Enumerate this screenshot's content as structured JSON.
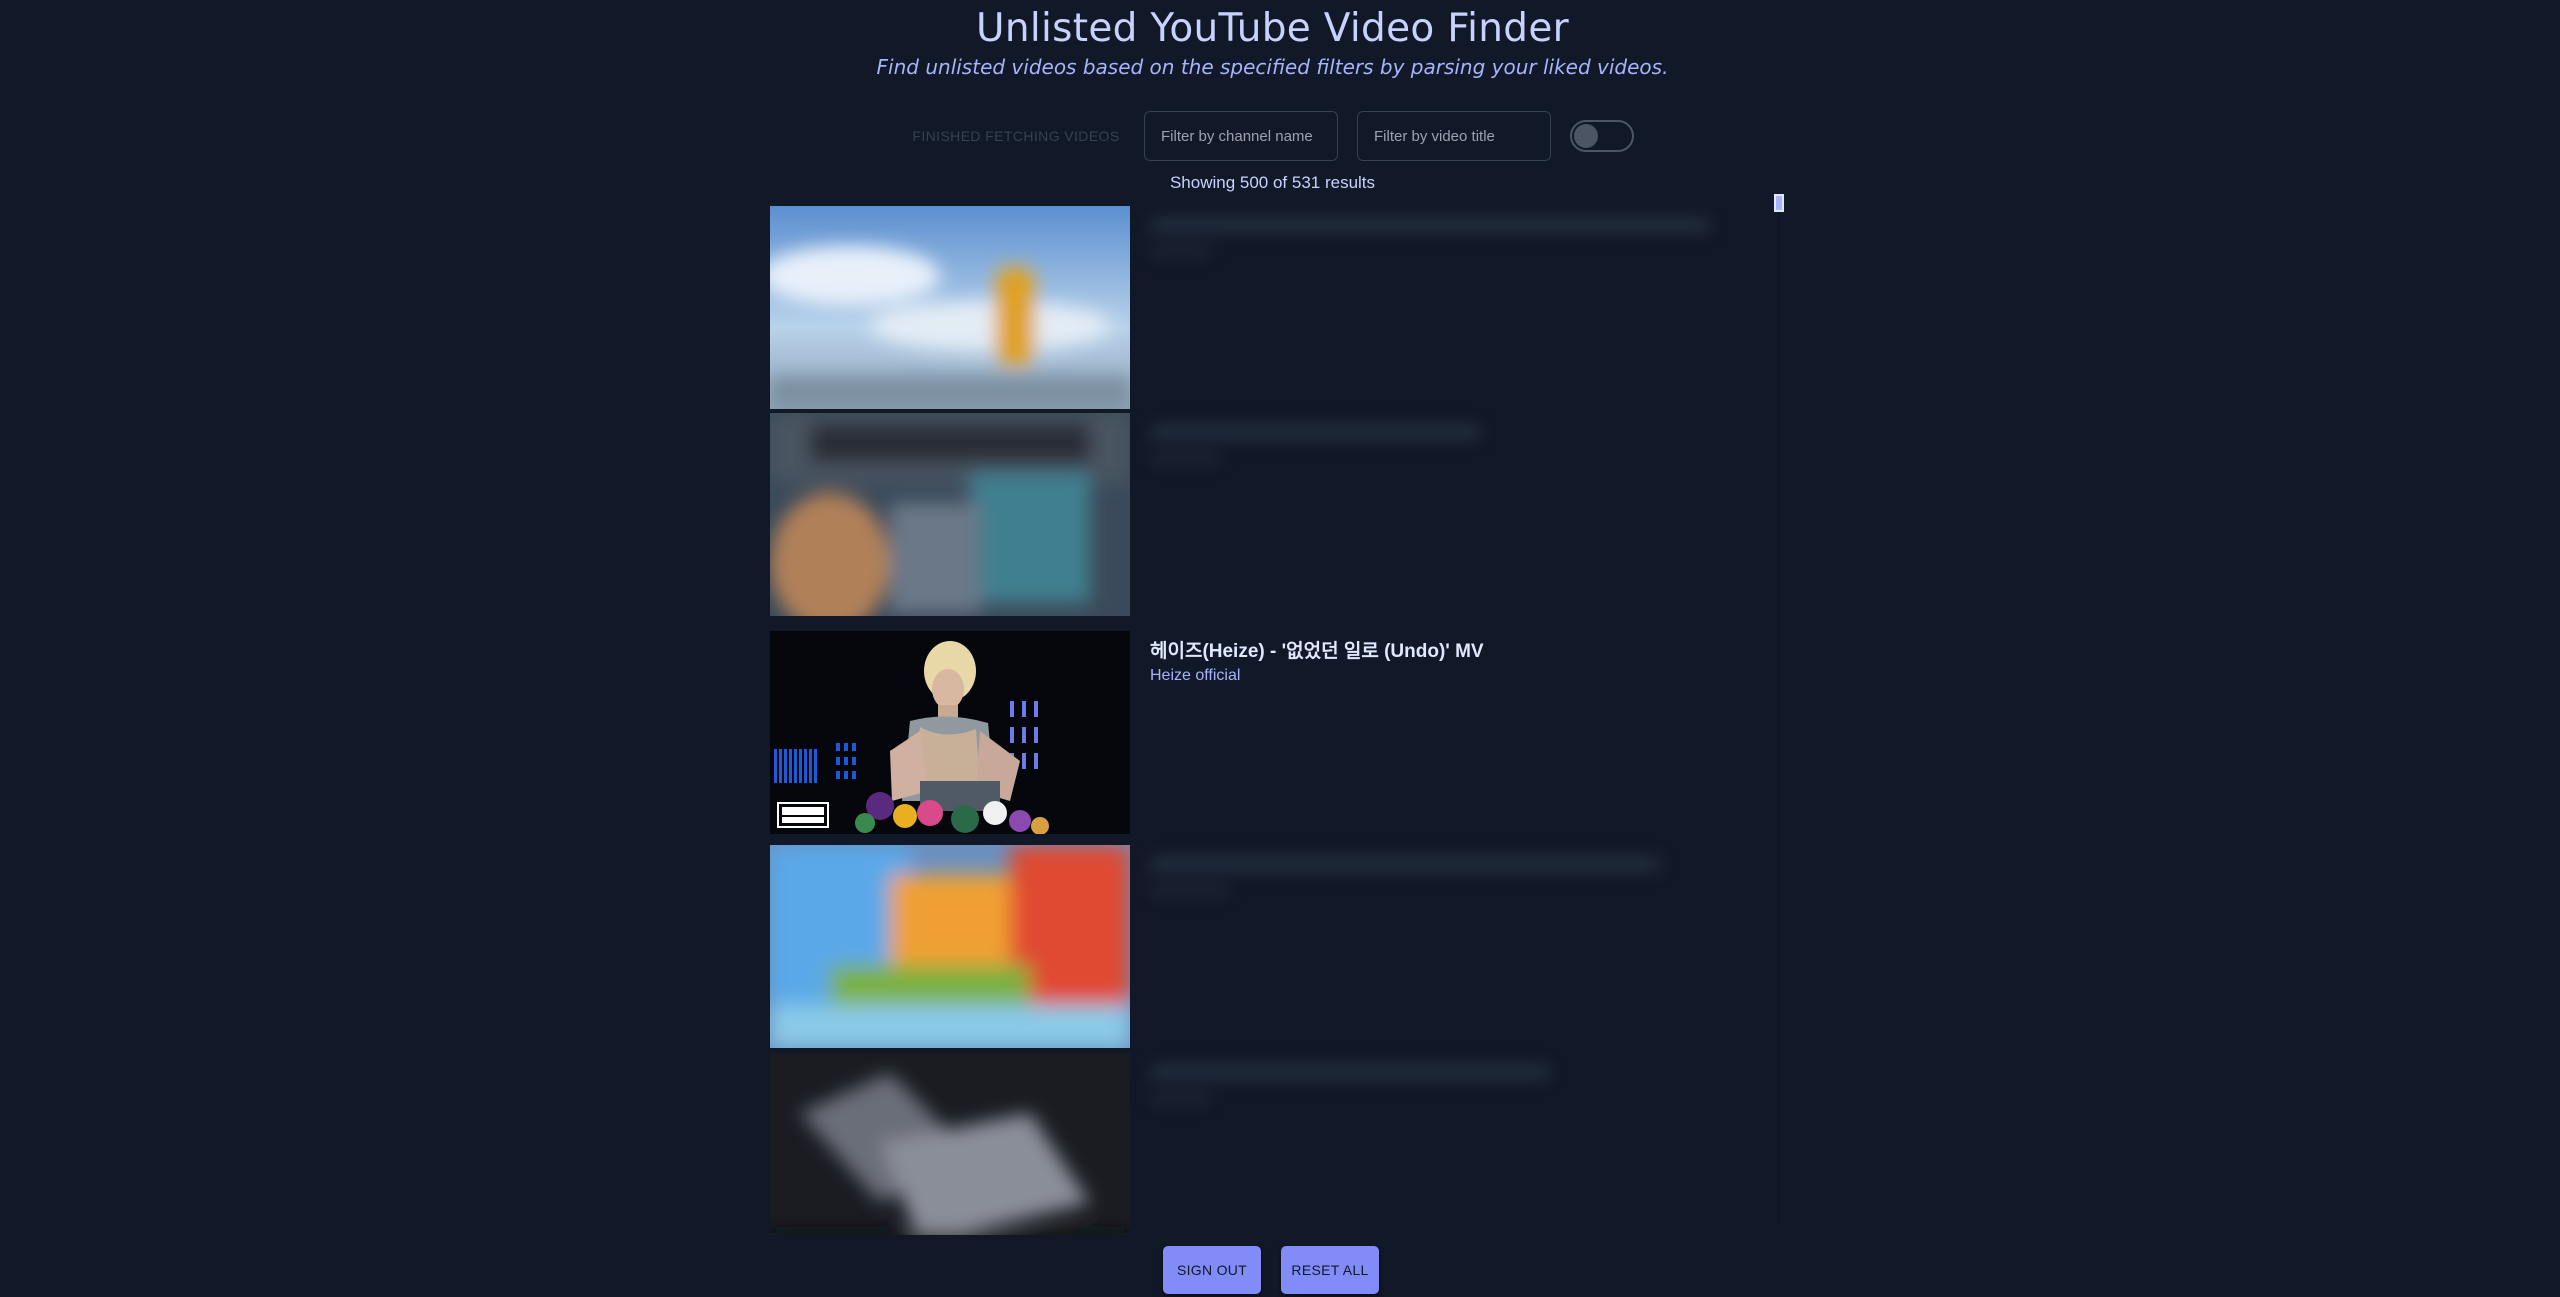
{
  "app": {
    "title": "Unlisted YouTube Video Finder",
    "subtitle": "Find unlisted videos based on the specified filters by parsing your liked videos."
  },
  "controls": {
    "status_label": "FINISHED FETCHING VIDEOS",
    "channel_filter_placeholder": "Filter by channel name",
    "title_filter_placeholder": "Filter by video title",
    "toggle_on": false
  },
  "results": {
    "summary": "Showing 500 of 531 results"
  },
  "videos": [
    {
      "title": "",
      "channel": "",
      "thumbnail": "blurred-sky-figure",
      "blurred": true
    },
    {
      "title": "",
      "channel": "",
      "thumbnail": "blurred-person",
      "blurred": true
    },
    {
      "title": "헤이즈(Heize) - '없었던 일로 (Undo)' MV",
      "channel": "Heize official",
      "thumbnail": "heize-undo-mv",
      "blurred": false
    },
    {
      "title": "",
      "channel": "",
      "thumbnail": "blurred-colorful",
      "blurred": true
    },
    {
      "title": "",
      "channel": "",
      "thumbnail": "blurred-keyboard",
      "blurred": true
    }
  ],
  "footer": {
    "sign_out": "SIGN OUT",
    "reset_all": "RESET ALL"
  },
  "colors": {
    "background": "#111827",
    "accent": "#818cf8",
    "text": "#c7d2fe"
  }
}
